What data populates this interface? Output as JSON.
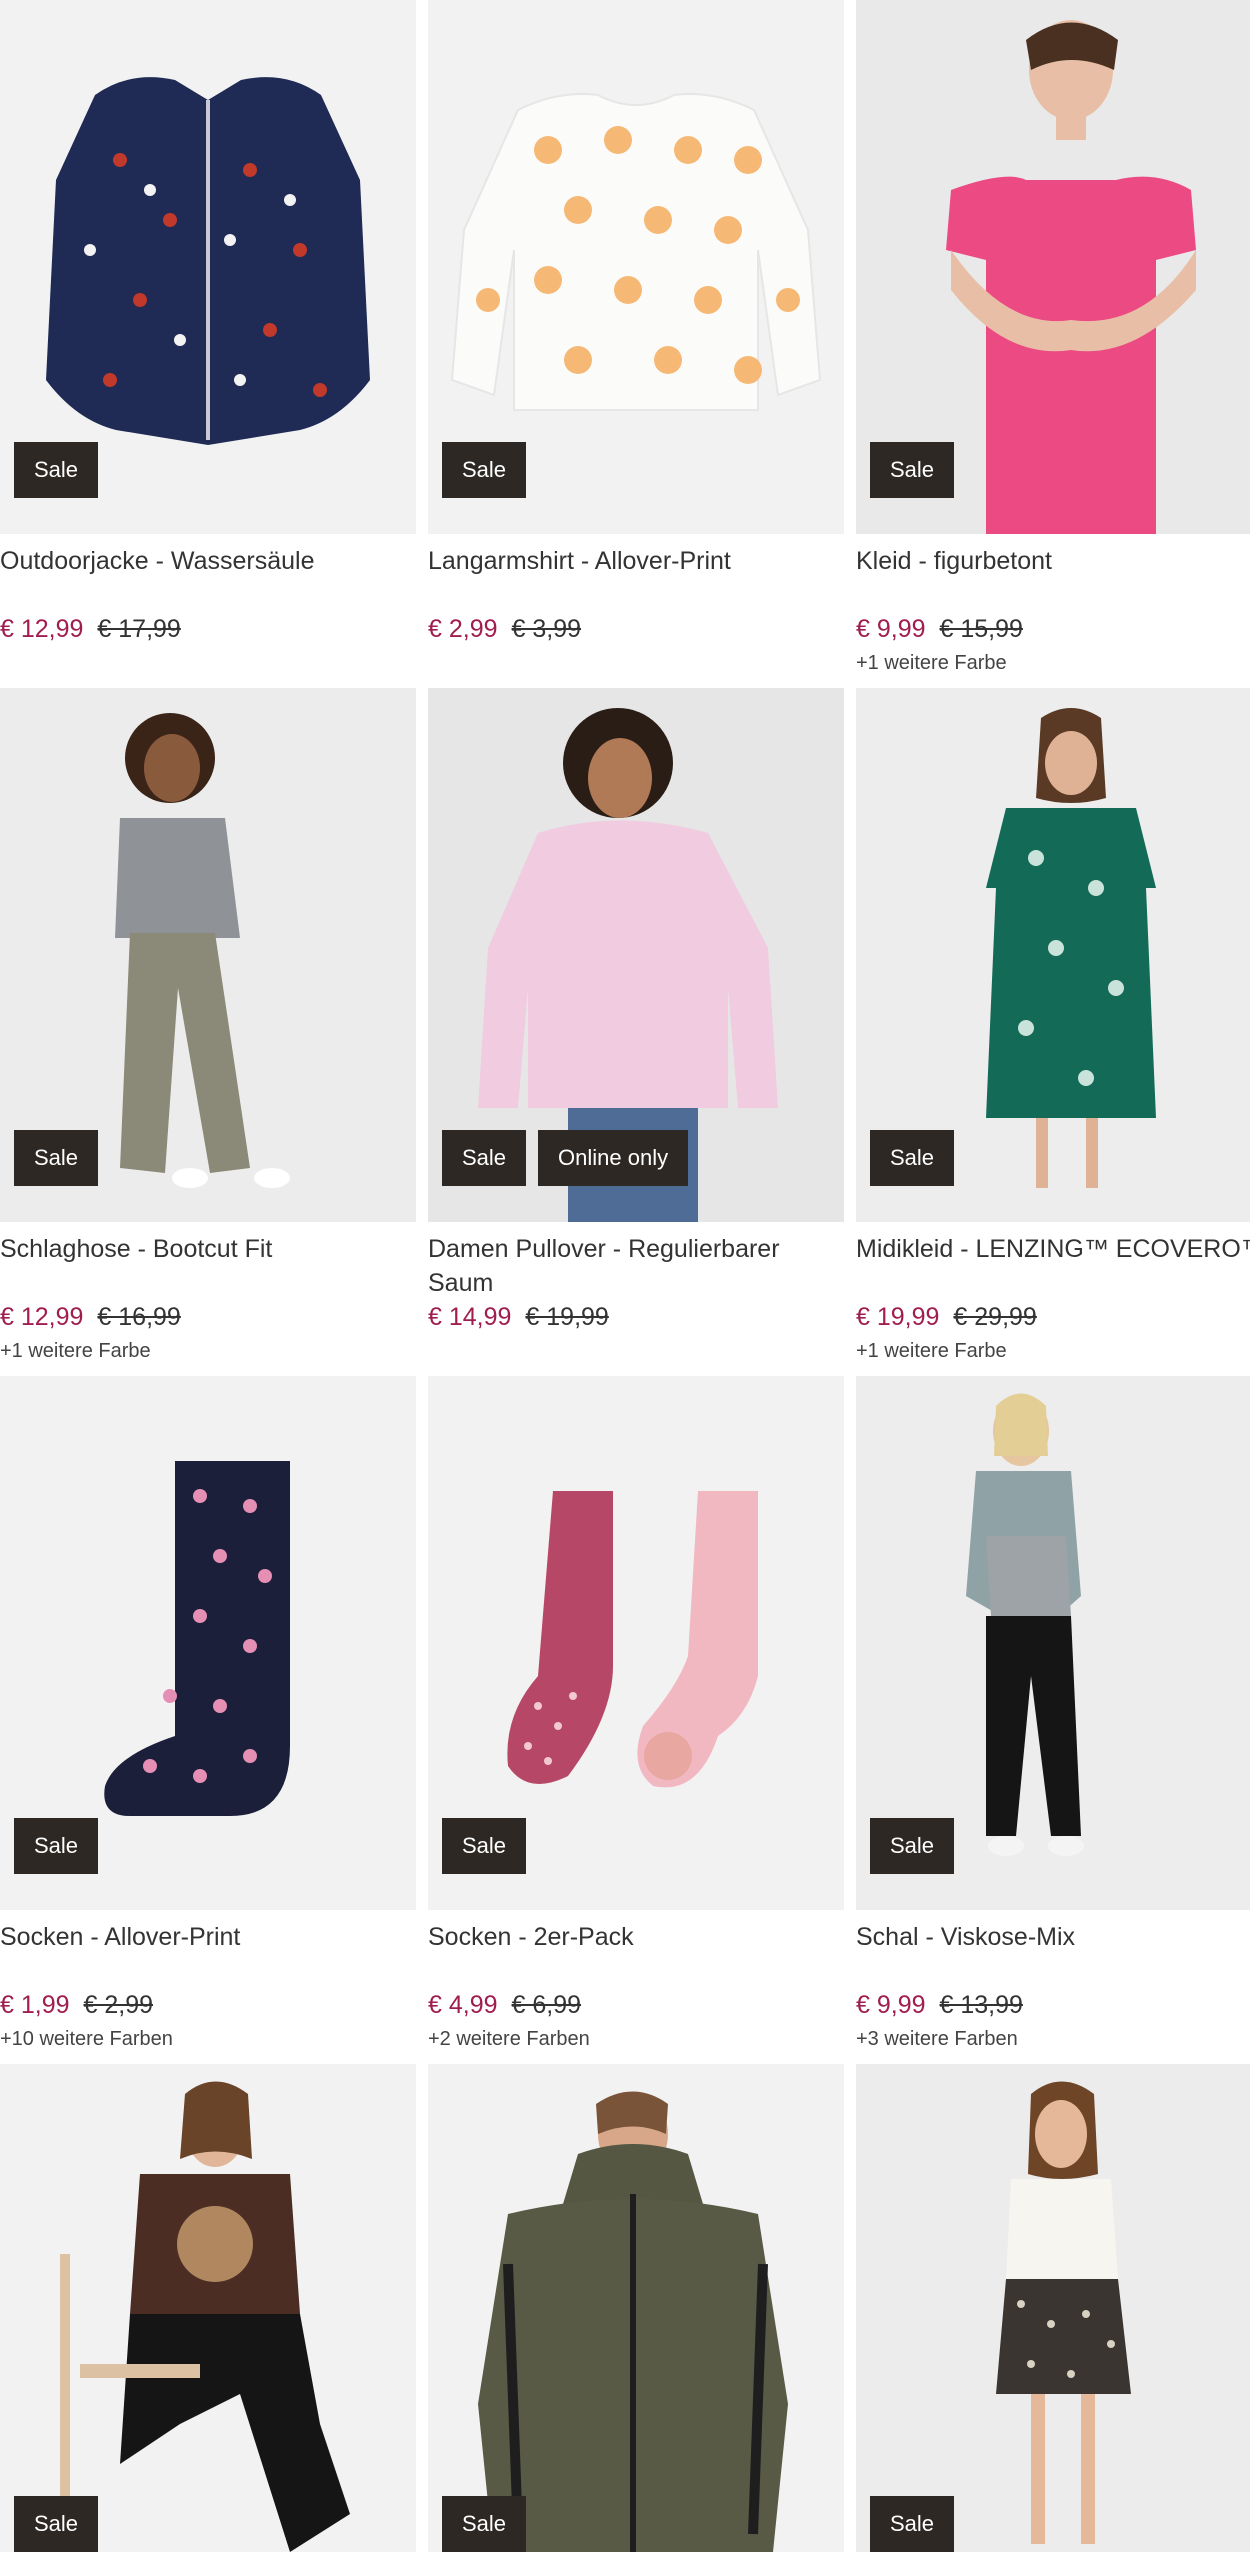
{
  "products": [
    {
      "title": "Outdoorjacke - Wassersäule",
      "price_new": "€ 12,99",
      "price_old": "€ 17,99",
      "colors_note": "",
      "badges": [
        "Sale"
      ],
      "image": "jacket-navy-floral"
    },
    {
      "title": "Langarmshirt - Allover-Print",
      "price_new": "€ 2,99",
      "price_old": "€ 3,99",
      "colors_note": "",
      "badges": [
        "Sale"
      ],
      "image": "shirt-flower-print"
    },
    {
      "title": "Kleid - figurbetont",
      "price_new": "€ 9,99",
      "price_old": "€ 15,99",
      "colors_note": "+1 weitere Farbe",
      "badges": [
        "Sale"
      ],
      "image": "pink-dress"
    },
    {
      "title": "Schlaghose - Bootcut Fit",
      "price_new": "€ 12,99",
      "price_old": "€ 16,99",
      "colors_note": "+1 weitere Farbe",
      "badges": [
        "Sale"
      ],
      "image": "bootcut-pants"
    },
    {
      "title": "Damen Pullover - Regulierbarer Saum",
      "price_new": "€ 14,99",
      "price_old": "€ 19,99",
      "colors_note": "",
      "badges": [
        "Sale",
        "Online only"
      ],
      "image": "pink-pullover"
    },
    {
      "title": "Midikleid - LENZING™ ECOVERO™",
      "price_new": "€ 19,99",
      "price_old": "€ 29,99",
      "colors_note": "+1 weitere Farbe",
      "badges": [
        "Sale"
      ],
      "image": "green-midi-dress"
    },
    {
      "title": "Socken - Allover-Print",
      "price_new": "€ 1,99",
      "price_old": "€ 2,99",
      "colors_note": "+10 weitere Farben",
      "badges": [
        "Sale"
      ],
      "image": "flamingo-socks"
    },
    {
      "title": "Socken - 2er-Pack",
      "price_new": "€ 4,99",
      "price_old": "€ 6,99",
      "colors_note": "+2 weitere Farben",
      "badges": [
        "Sale"
      ],
      "image": "pink-tights"
    },
    {
      "title": "Schal - Viskose-Mix",
      "price_new": "€ 9,99",
      "price_old": "€ 13,99",
      "colors_note": "+3 weitere Farben",
      "badges": [
        "Sale"
      ],
      "image": "grey-scarf"
    },
    {
      "title": "",
      "price_new": "",
      "price_old": "",
      "colors_note": "",
      "badges": [
        "Sale"
      ],
      "image": "brown-tshirt"
    },
    {
      "title": "",
      "price_new": "",
      "price_old": "",
      "colors_note": "",
      "badges": [
        "Sale"
      ],
      "image": "khaki-hoodie"
    },
    {
      "title": "",
      "price_new": "",
      "price_old": "",
      "colors_note": "",
      "badges": [
        "Sale"
      ],
      "image": "patterned-skirt"
    }
  ],
  "colors": {
    "sale_price": "#a01e4f",
    "badge_bg": "#2d2824",
    "badge_text": "#ffffff",
    "image_bg": "#f2f2f2"
  }
}
